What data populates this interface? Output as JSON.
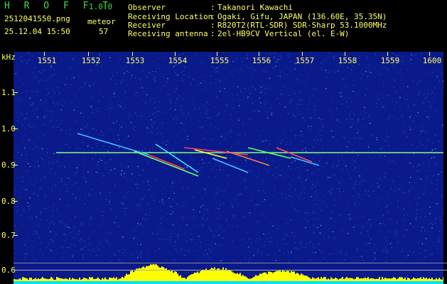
{
  "app": {
    "title": "H R O F F T",
    "version": "1.0.0"
  },
  "file": {
    "name": "2512041550.png",
    "datetime": "25.12.04 15:50"
  },
  "meteor": {
    "label": "meteor",
    "count": "57"
  },
  "info": {
    "rows": [
      {
        "key": "Observer",
        "sep": ":",
        "value": "Takanori Kawachi"
      },
      {
        "key": "Receiving Location",
        "sep": ":",
        "value": "Ogaki, Gifu, JAPAN (136.60E, 35.35N)"
      },
      {
        "key": "Receiver",
        "sep": ":",
        "value": "R820T2(RTL-SDR) SDR-Sharp 53.1000MHz"
      },
      {
        "key": "Receiving antenna",
        "sep": ":",
        "value": "2el-HB9CV Vertical (el. E-W)"
      }
    ]
  },
  "axis": {
    "x_unit": "",
    "x_ticks": [
      "1551",
      "1552",
      "1553",
      "1554",
      "1555",
      "1556",
      "1557",
      "1558",
      "1559",
      "1600"
    ],
    "y_unit": "kHz",
    "y_ticks": [
      "1.1",
      "1.0",
      "0.9",
      "0.8",
      "0.7",
      "0.6"
    ]
  },
  "colors": {
    "text": "#ffff66",
    "title": "#3fe03f",
    "background_noise": "#0a1a8a",
    "signal_line": "#7fff7f",
    "activity_bar": "#ffff00",
    "bottom_band": "#00e0ff"
  }
}
